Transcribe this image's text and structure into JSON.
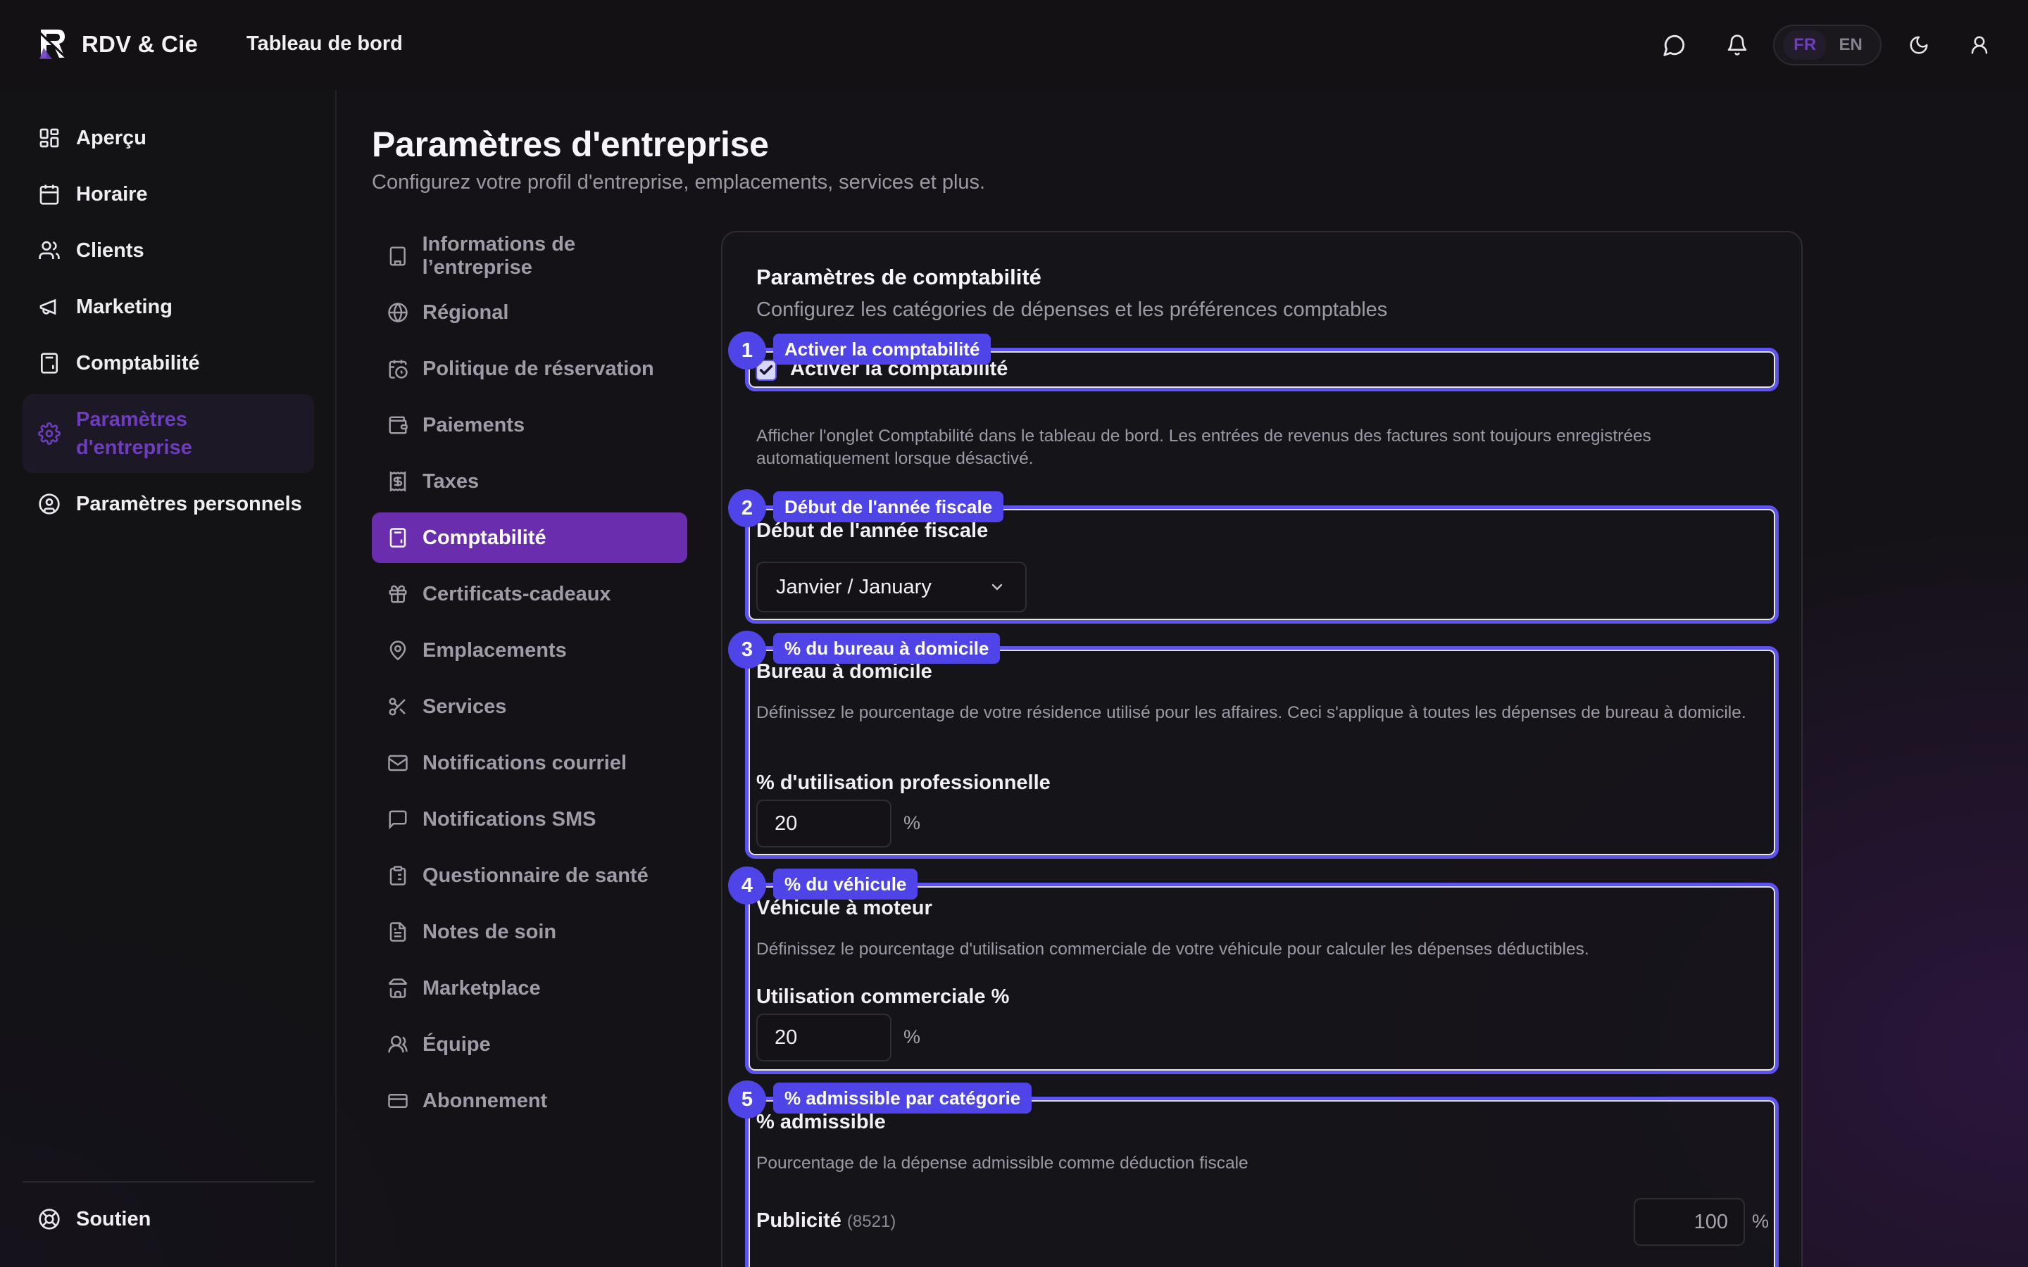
{
  "header": {
    "brand": "RDV & Cie",
    "title": "Tableau de bord",
    "lang": {
      "fr": "FR",
      "en": "EN"
    }
  },
  "sidebar": {
    "items": [
      {
        "label": "Aperçu",
        "icon": "dashboard-icon"
      },
      {
        "label": "Horaire",
        "icon": "calendar-icon"
      },
      {
        "label": "Clients",
        "icon": "users-icon"
      },
      {
        "label": "Marketing",
        "icon": "megaphone-icon"
      },
      {
        "label": "Comptabilité",
        "icon": "calculator-icon"
      },
      {
        "label": "Paramètres d'entreprise",
        "line1": "Paramètres",
        "line2": "d'entreprise",
        "icon": "gear-icon",
        "active": true
      },
      {
        "label": "Paramètres personnels",
        "icon": "user-circle-icon"
      }
    ],
    "support": "Soutien"
  },
  "page": {
    "title": "Paramètres d'entreprise",
    "subtitle": "Configurez votre profil d'entreprise, emplacements, services et plus."
  },
  "subnav": [
    {
      "label": "Informations de l’entreprise",
      "icon": "building-icon"
    },
    {
      "label": "Régional",
      "icon": "globe-icon"
    },
    {
      "label": "Politique de réservation",
      "icon": "calendar-clock-icon"
    },
    {
      "label": "Paiements",
      "icon": "wallet-icon"
    },
    {
      "label": "Taxes",
      "icon": "receipt-icon"
    },
    {
      "label": "Comptabilité",
      "icon": "calculator-icon",
      "active": true
    },
    {
      "label": "Certificats-cadeaux",
      "icon": "gift-icon"
    },
    {
      "label": "Emplacements",
      "icon": "map-pin-icon"
    },
    {
      "label": "Services",
      "icon": "scissors-icon"
    },
    {
      "label": "Notifications courriel",
      "icon": "mail-icon"
    },
    {
      "label": "Notifications SMS",
      "icon": "message-square-icon"
    },
    {
      "label": "Questionnaire de santé",
      "icon": "clipboard-icon"
    },
    {
      "label": "Notes de soin",
      "icon": "file-text-icon"
    },
    {
      "label": "Marketplace",
      "icon": "store-icon"
    },
    {
      "label": "Équipe",
      "icon": "team-icon"
    },
    {
      "label": "Abonnement",
      "icon": "credit-card-icon"
    }
  ],
  "panel": {
    "title": "Paramètres de comptabilité",
    "subtitle": "Configurez les catégories de dépenses et les préférences comptables",
    "enable": {
      "badge": "1",
      "badge_label": "Activer la comptabilité",
      "checkbox_label": "Activer la comptabilité",
      "checked": true,
      "help": "Afficher l'onglet Comptabilité dans le tableau de bord. Les entrées de revenus des factures sont toujours enregistrées automatiquement lorsque désactivé."
    },
    "fiscal": {
      "badge": "2",
      "badge_label": "Début de l'année fiscale",
      "title": "Début de l'année fiscale",
      "value": "Janvier / January"
    },
    "home_office": {
      "badge": "3",
      "badge_label": "% du bureau à domicile",
      "title": "Bureau à domicile",
      "help": "Définissez le pourcentage de votre résidence utilisé pour les affaires. Ceci s'applique à toutes les dépenses de bureau à domicile.",
      "field_label": "% d'utilisation professionnelle",
      "value": "20",
      "unit": "%"
    },
    "vehicle": {
      "badge": "4",
      "badge_label": "% du véhicule",
      "title": "Véhicule à moteur",
      "help": "Définissez le pourcentage d'utilisation commerciale de votre véhicule pour calculer les dépenses déductibles.",
      "field_label": "Utilisation commerciale %",
      "value": "20",
      "unit": "%"
    },
    "eligible": {
      "badge": "5",
      "badge_label": "% admissible par catégorie",
      "title": "% admissible",
      "help": "Pourcentage de la dépense admissible comme déduction fiscale",
      "rows": [
        {
          "label": "Publicité",
          "code": "(8521)",
          "value": "100",
          "unit": "%"
        }
      ]
    }
  }
}
